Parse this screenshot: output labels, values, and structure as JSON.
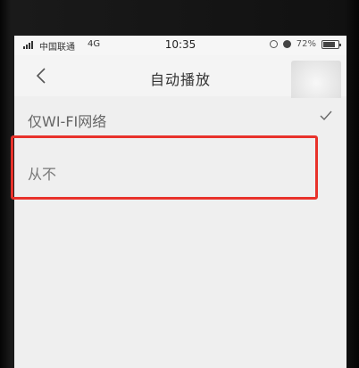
{
  "status_bar": {
    "carrier": "中国联通",
    "network": "4G",
    "time": "10:35",
    "battery": "72%"
  },
  "nav": {
    "title": "自动播放",
    "back_icon": "chevron-left-icon"
  },
  "options": [
    {
      "label": "仅WI-FI网络",
      "selected": true
    },
    {
      "label": "从不",
      "selected": false
    }
  ],
  "colors": {
    "highlight": "#e8322b",
    "background": "#efefef"
  }
}
